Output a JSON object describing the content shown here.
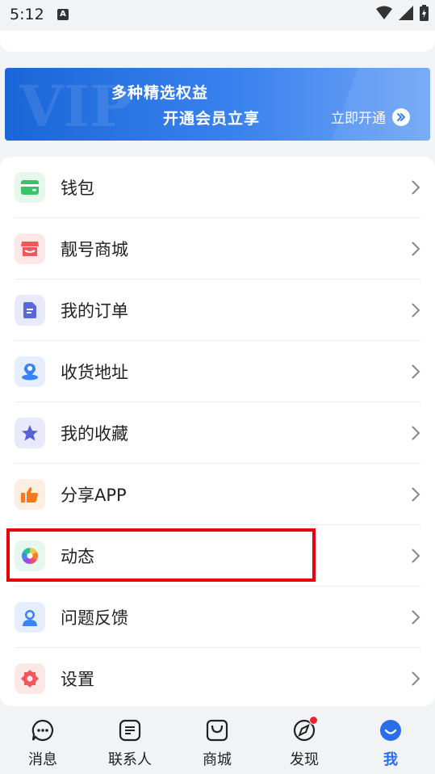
{
  "status_bar": {
    "time": "5:12",
    "a_badge": "A"
  },
  "vip": {
    "watermark": "VIP",
    "title": "多种精选权益",
    "subtitle": "开通会员立享",
    "button": "立即开通"
  },
  "menu": {
    "items": [
      {
        "label": "钱包",
        "icon": "wallet-icon",
        "color": "#35c46a",
        "bg": "#e6f7ec"
      },
      {
        "label": "靓号商城",
        "icon": "store-icon",
        "color": "#f0575a",
        "bg": "#fde8e8"
      },
      {
        "label": "我的订单",
        "icon": "order-doc-icon",
        "color": "#5b67d8",
        "bg": "#e8eafb"
      },
      {
        "label": "收货地址",
        "icon": "location-pin-icon",
        "color": "#3b82f6",
        "bg": "#e4eefd"
      },
      {
        "label": "我的收藏",
        "icon": "star-icon",
        "color": "#5b5fd6",
        "bg": "#e8e9fb"
      },
      {
        "label": "分享APP",
        "icon": "thumbs-up-icon",
        "color": "#f57a1f",
        "bg": "#fdeee2"
      },
      {
        "label": "动态",
        "icon": "aperture-icon",
        "color": "#2ec38a",
        "bg": "#e6f7ef"
      },
      {
        "label": "问题反馈",
        "icon": "customer-service-icon",
        "color": "#3b82f6",
        "bg": "#e4eefd"
      },
      {
        "label": "设置",
        "icon": "gear-icon",
        "color": "#f0575a",
        "bg": "#fde8e8"
      }
    ]
  },
  "tabs": [
    {
      "label": "消息",
      "icon": "message-bubble-icon",
      "active": false
    },
    {
      "label": "联系人",
      "icon": "contacts-icon",
      "active": false
    },
    {
      "label": "商城",
      "icon": "shopping-bag-icon",
      "active": false
    },
    {
      "label": "发现",
      "icon": "compass-icon",
      "active": false,
      "badge": true
    },
    {
      "label": "我",
      "icon": "smile-profile-icon",
      "active": true
    }
  ],
  "colors": {
    "accent": "#2b6de9",
    "highlight": "#e8000a",
    "badge": "#f0202a"
  }
}
